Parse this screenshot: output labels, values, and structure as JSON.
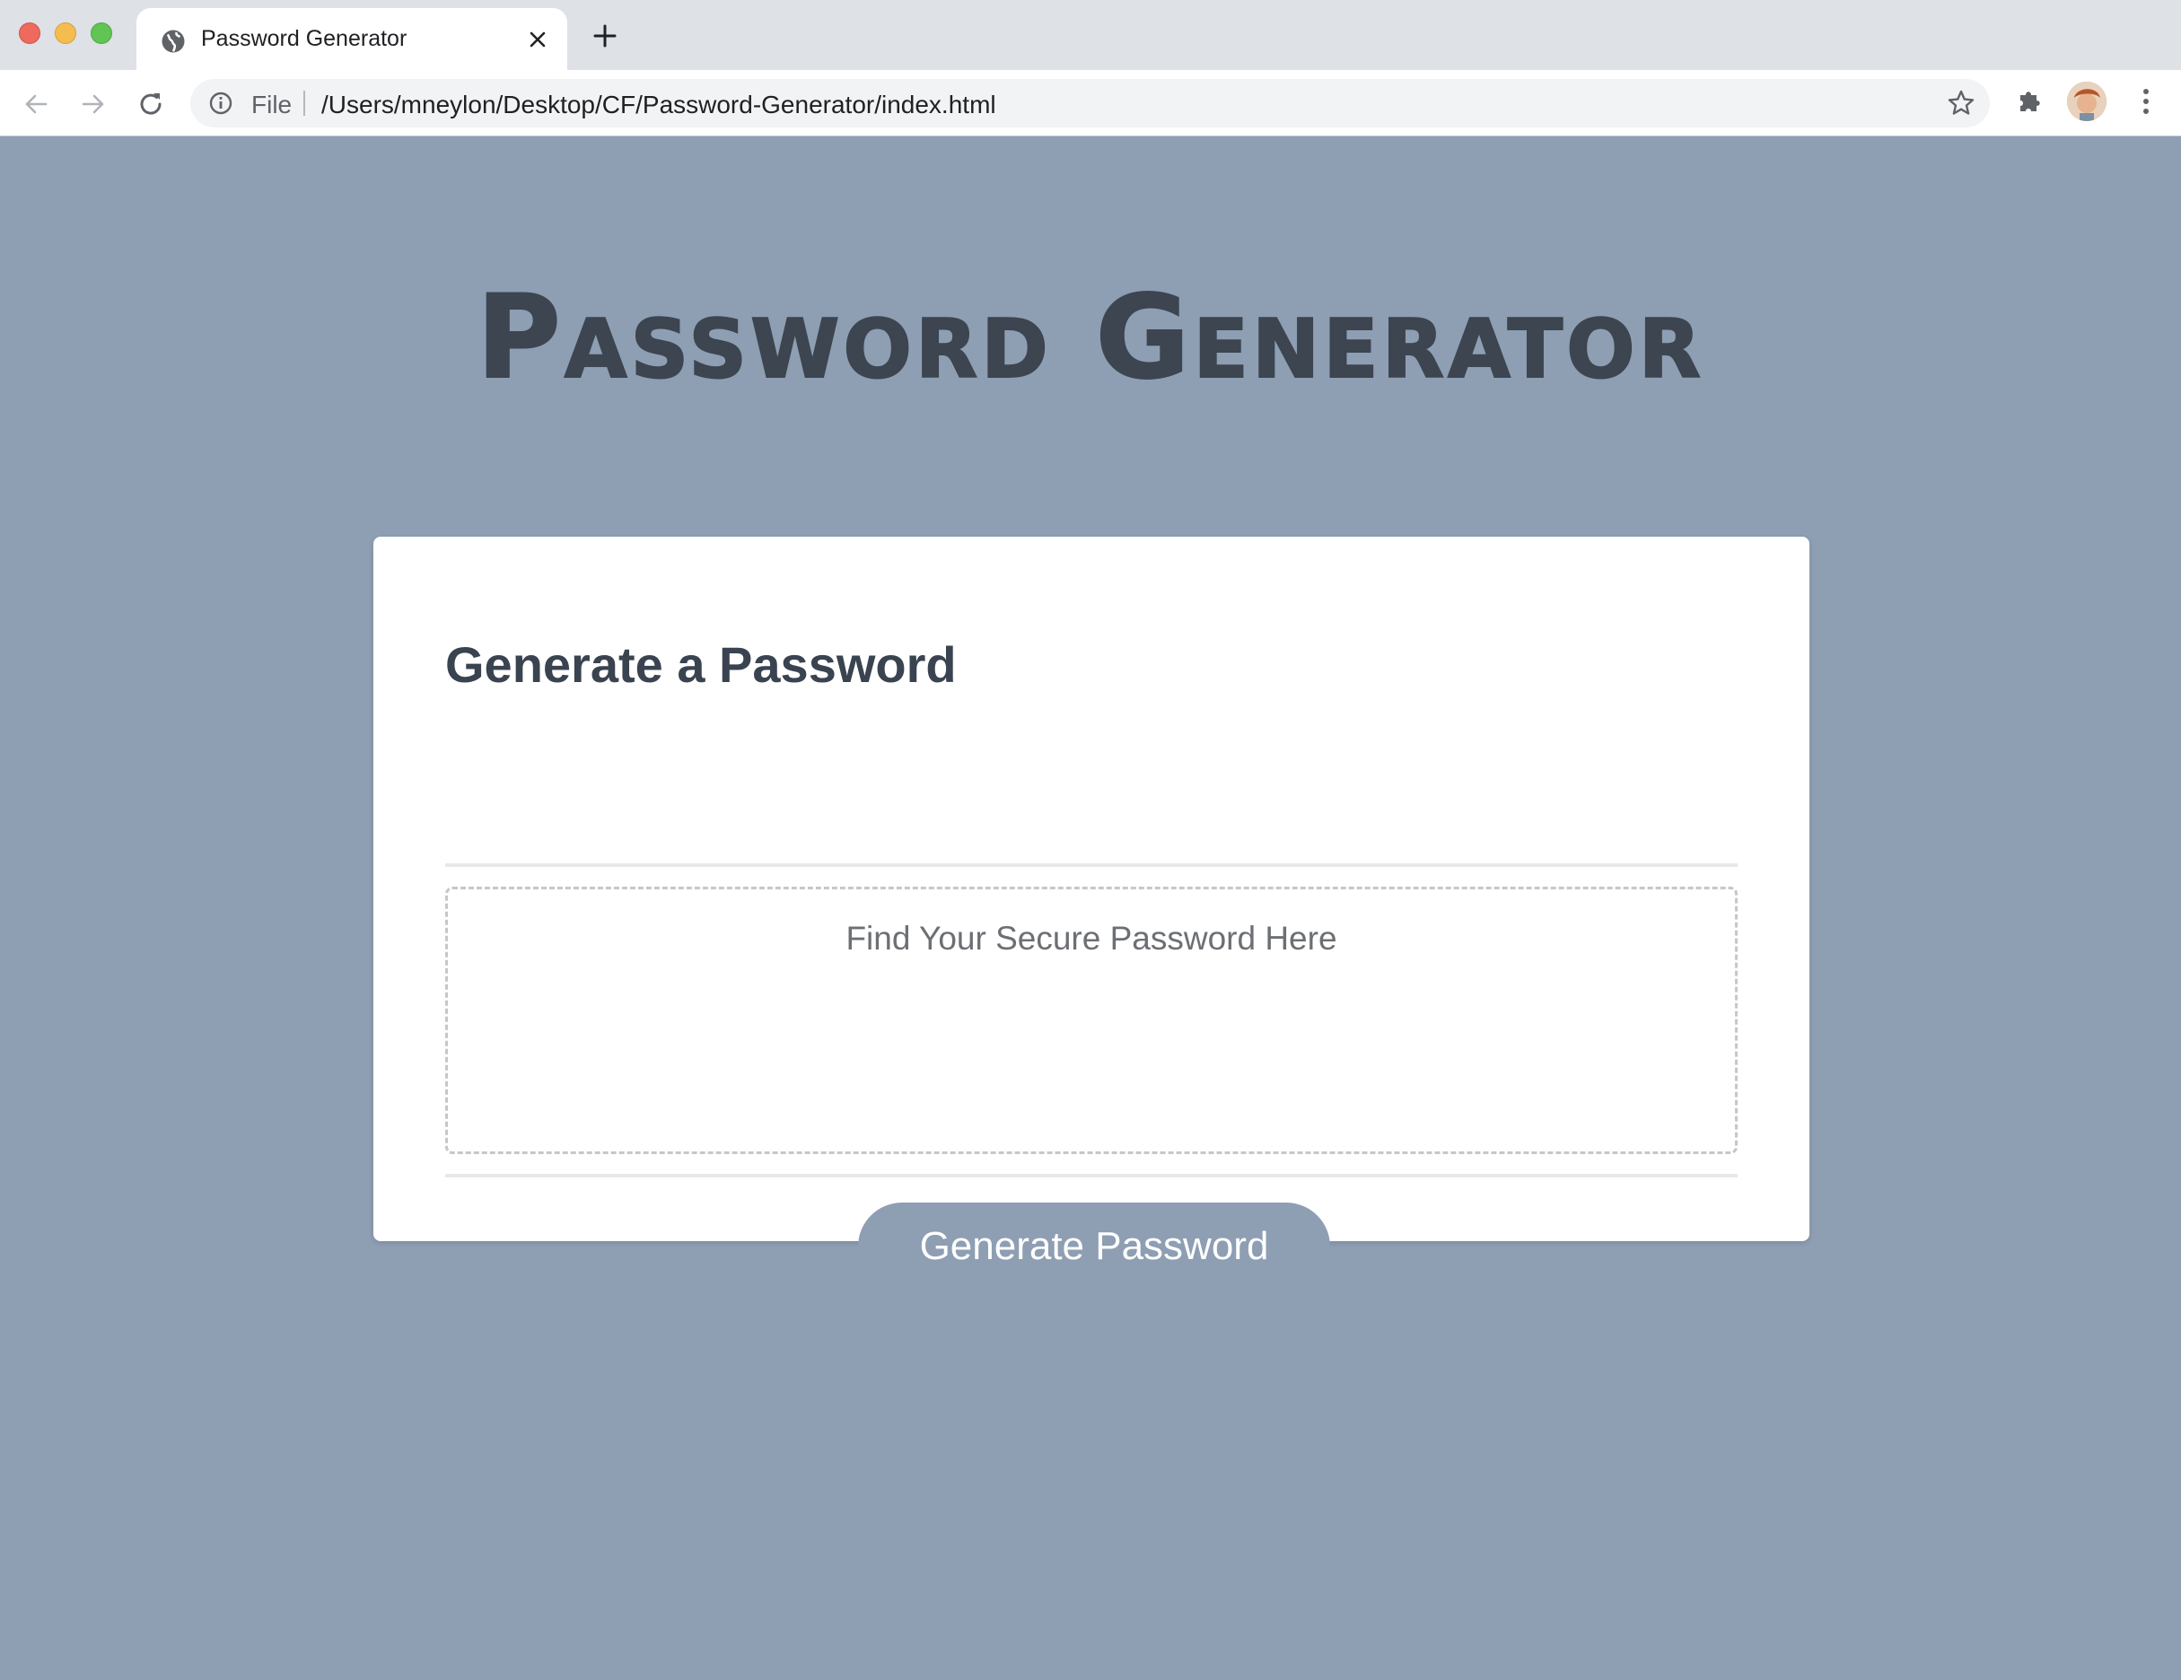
{
  "browser": {
    "tab_title": "Password Generator",
    "scheme_label": "File",
    "url": "/Users/mneylon/Desktop/CF/Password-Generator/index.html",
    "icons": {
      "favicon": "globe-icon",
      "close": "close-icon",
      "new_tab": "plus-icon",
      "back": "arrow-left-icon",
      "forward": "arrow-right-icon",
      "reload": "reload-icon",
      "info": "info-icon",
      "bookmark": "star-icon",
      "extensions": "puzzle-icon",
      "menu": "kebab-menu-icon"
    }
  },
  "page": {
    "headline": "Password Generator",
    "card": {
      "title": "Generate a Password",
      "output_placeholder": "Find Your Secure Password Here",
      "button_label": "Generate Password"
    }
  },
  "colors": {
    "background": "#8e9eb3",
    "headline": "#3c4550",
    "card": "#ffffff",
    "button": "#8e9eb3",
    "button_text": "#ffffff"
  }
}
